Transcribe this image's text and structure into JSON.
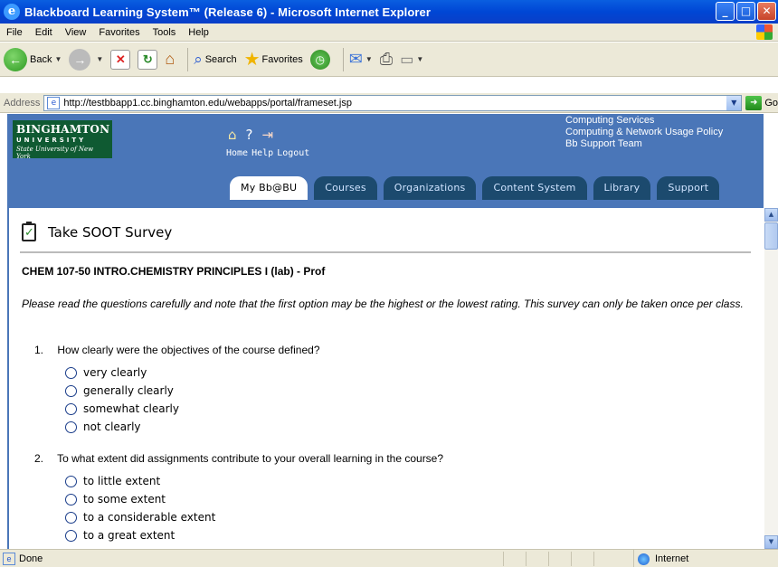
{
  "window": {
    "title": "Blackboard Learning System™ (Release 6) - Microsoft Internet Explorer",
    "controls": [
      "minimize",
      "maximize",
      "close"
    ]
  },
  "menubar": {
    "items": [
      "File",
      "Edit",
      "View",
      "Favorites",
      "Tools",
      "Help"
    ]
  },
  "toolbar": {
    "back_label": "Back",
    "search_label": "Search",
    "favorites_label": "Favorites"
  },
  "address": {
    "label": "Address",
    "url": "http://testbbapp1.cc.binghamton.edu/webapps/portal/frameset.jsp",
    "go_label": "Go"
  },
  "header": {
    "logo": {
      "line1": "BINGHAMTON",
      "line2": "UNIVERSITY",
      "line3": "State University of New York"
    },
    "nav_labels": [
      "Home",
      "Help",
      "Logout"
    ],
    "links": [
      "Computing Services",
      "Computing & Network Usage Policy",
      "Bb Support Team"
    ],
    "tabs": [
      "My Bb@BU",
      "Courses",
      "Organizations",
      "Content System",
      "Library",
      "Support"
    ],
    "active_tab": "My Bb@BU"
  },
  "survey": {
    "title": "Take SOOT Survey",
    "course": "CHEM 107-50 INTRO.CHEMISTRY PRINCIPLES I (lab) - Prof",
    "instructions": "Please read the questions carefully and note that the first option may be the highest or the lowest rating. This survey can only be taken once per class.",
    "questions": [
      {
        "number": "1.",
        "text": "How clearly were the objectives of the course defined?",
        "options": [
          "very clearly",
          "generally clearly",
          "somewhat clearly",
          "not clearly"
        ]
      },
      {
        "number": "2.",
        "text": "To what extent did assignments contribute to your overall learning in the course?",
        "options": [
          "to little extent",
          "to some extent",
          "to a considerable extent",
          "to a great extent"
        ]
      }
    ]
  },
  "status": {
    "text": "Done",
    "zone": "Internet"
  },
  "colors": {
    "titlebar": "#0046d5",
    "header_blue": "#4a76b8",
    "tab_dark": "#1c4a6e",
    "logo_green": "#0f5a32"
  }
}
